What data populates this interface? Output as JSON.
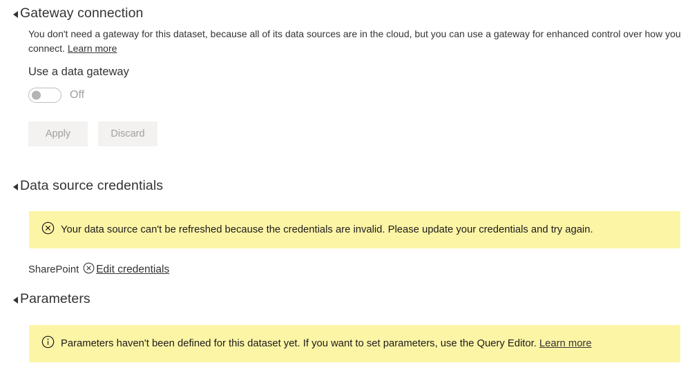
{
  "colors": {
    "banner_background": "#fdf5a6",
    "text": "#333333",
    "disabled_text": "#a19f9d",
    "button_background": "#f3f2f1",
    "toggle_border": "#bdbdbd",
    "toggle_knob": "#b4b4b4"
  },
  "gateway_section": {
    "title": "Gateway connection",
    "collapse_icon": "triangle-collapse-icon",
    "description": "You don't need a gateway for this dataset, because all of its data sources are in the cloud, but you can use a gateway for enhanced control over how you connect. ",
    "learn_more_label": "Learn more",
    "toggle_label": "Use a data gateway",
    "toggle_state": "Off",
    "toggle_checked": false,
    "apply_label": "Apply",
    "discard_label": "Discard",
    "buttons_disabled": true
  },
  "credentials_section": {
    "title": "Data source credentials",
    "collapse_icon": "triangle-collapse-icon",
    "banner": {
      "icon": "error-circle-x-icon",
      "message": "Your data source can't be refreshed because the credentials are invalid. Please update your credentials and try again."
    },
    "data_source": {
      "name": "SharePoint",
      "status_icon": "error-circle-x-icon",
      "edit_link_label": "Edit credentials"
    }
  },
  "parameters_section": {
    "title": "Parameters",
    "collapse_icon": "triangle-collapse-icon",
    "banner": {
      "icon": "info-circle-icon",
      "message": "Parameters haven't been defined for this dataset yet. If you want to set parameters, use the Query Editor. ",
      "learn_more_label": "Learn more"
    }
  }
}
